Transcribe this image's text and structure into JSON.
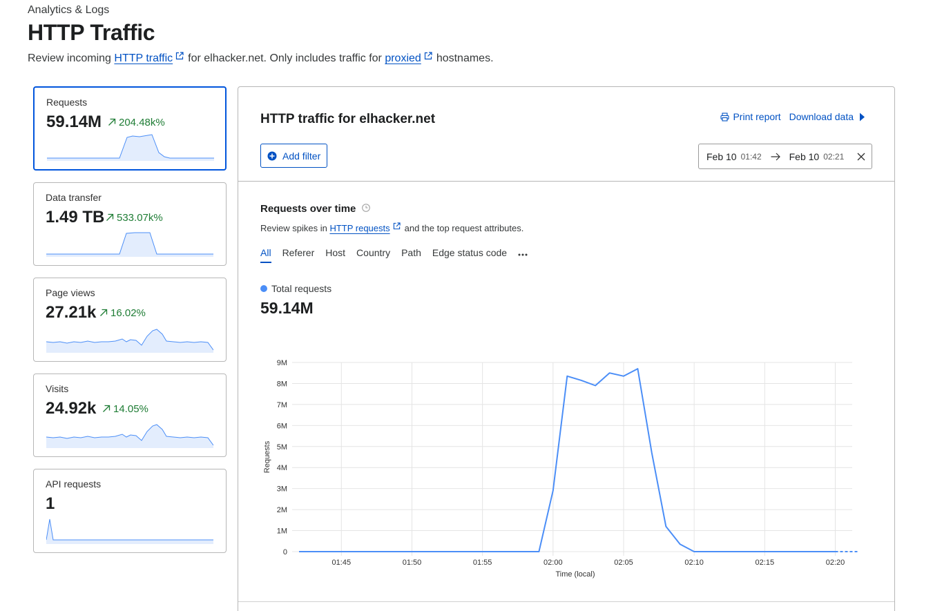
{
  "header": {
    "breadcrumb": "Analytics & Logs",
    "title": "HTTP Traffic",
    "desc_before": "Review incoming ",
    "desc_link1": "HTTP traffic",
    "desc_middle": "for elhacker.net. Only includes traffic for ",
    "desc_link2": "proxied",
    "desc_after": "hostnames."
  },
  "cards": [
    {
      "label": "Requests",
      "value": "59.14M",
      "change": "204.48k%"
    },
    {
      "label": "Data transfer",
      "value": "1.49 TB",
      "change": "533.07k%"
    },
    {
      "label": "Page views",
      "value": "27.21k",
      "change": "16.02%"
    },
    {
      "label": "Visits",
      "value": "24.92k",
      "change": "14.05%"
    },
    {
      "label": "API requests",
      "value": "1"
    }
  ],
  "panel": {
    "title": "HTTP traffic for elhacker.net",
    "print_label": "Print report",
    "download_label": "Download data",
    "add_filter_label": "Add filter",
    "date_from": "Feb 10",
    "time_from": "01:42",
    "date_to": "Feb 10",
    "time_to": "02:21"
  },
  "section": {
    "title": "Requests over time",
    "desc_before": "Review spikes in ",
    "desc_link": "HTTP requests",
    "desc_after": "and the top request attributes.",
    "tabs": [
      "All",
      "Referer",
      "Host",
      "Country",
      "Path",
      "Edge status code"
    ],
    "legend_label": "Total requests",
    "total": "59.14M"
  },
  "colors": {
    "accent": "#0051c3",
    "series": "#4b8ef7",
    "positive": "#1e7c34"
  },
  "chart_data": {
    "type": "line",
    "xlabel": "Time (local)",
    "ylabel": "Requests",
    "ylim": [
      0,
      9000000
    ],
    "yticks": [
      "0",
      "1M",
      "2M",
      "3M",
      "4M",
      "5M",
      "6M",
      "7M",
      "8M",
      "9M"
    ],
    "xticks": [
      "01:45",
      "01:50",
      "01:55",
      "02:00",
      "02:05",
      "02:10",
      "02:15",
      "02:20"
    ],
    "grid": true,
    "series": [
      {
        "name": "Total requests",
        "x": [
          "01:42",
          "01:43",
          "01:44",
          "01:45",
          "01:46",
          "01:47",
          "01:48",
          "01:49",
          "01:50",
          "01:51",
          "01:52",
          "01:53",
          "01:54",
          "01:55",
          "01:56",
          "01:57",
          "01:58",
          "01:59",
          "02:00",
          "02:01",
          "02:02",
          "02:03",
          "02:04",
          "02:05",
          "02:06",
          "02:07",
          "02:08",
          "02:09",
          "02:10",
          "02:11",
          "02:12",
          "02:13",
          "02:14",
          "02:15",
          "02:16",
          "02:17",
          "02:18",
          "02:19",
          "02:20",
          "02:21"
        ],
        "values": [
          0,
          0,
          0,
          0,
          0,
          0,
          0,
          0,
          0,
          0,
          0,
          0,
          0,
          0,
          0,
          0,
          0,
          0,
          2900000,
          8350000,
          8150000,
          7900000,
          8500000,
          8350000,
          8700000,
          4700000,
          1200000,
          350000,
          0,
          0,
          0,
          0,
          0,
          0,
          0,
          0,
          0,
          0,
          0,
          0
        ]
      }
    ]
  }
}
